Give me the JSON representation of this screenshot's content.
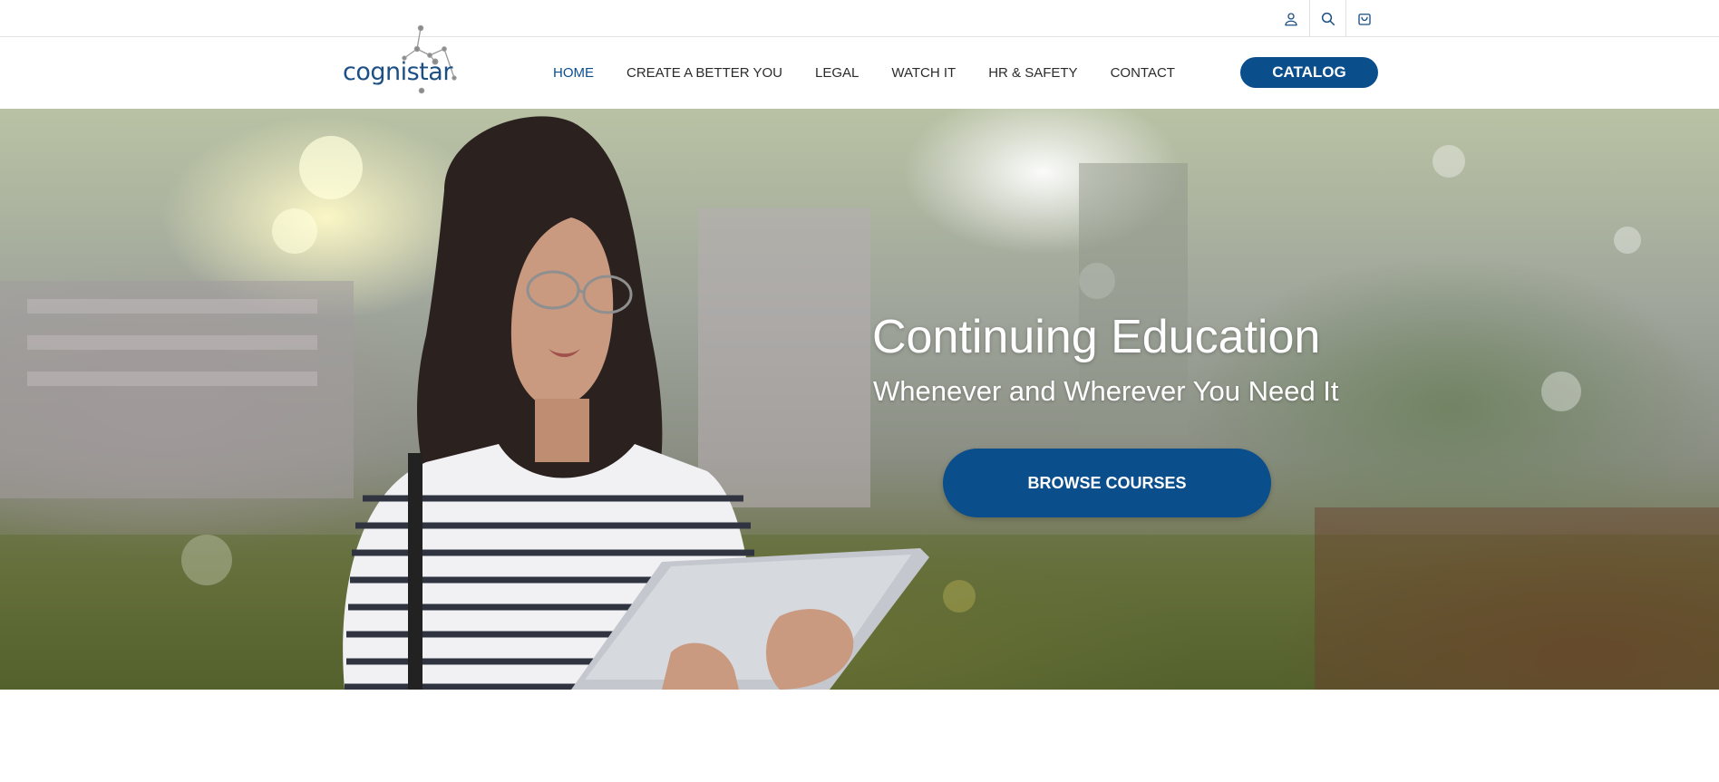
{
  "utility": {
    "icons": [
      "user-icon",
      "search-icon",
      "cart-icon"
    ]
  },
  "brand": {
    "logo_text": "cognistar",
    "accent_color": "#0a4e8c"
  },
  "nav": {
    "items": [
      {
        "label": "HOME",
        "active": true
      },
      {
        "label": "CREATE A BETTER YOU",
        "active": false
      },
      {
        "label": "LEGAL",
        "active": false
      },
      {
        "label": "WATCH IT",
        "active": false
      },
      {
        "label": "HR & SAFETY",
        "active": false
      },
      {
        "label": "CONTACT",
        "active": false
      }
    ],
    "catalog_label": "CATALOG"
  },
  "hero": {
    "title": "Continuing Education",
    "subtitle": "Whenever and Wherever You Need It",
    "button_label": "BROWSE COURSES"
  }
}
